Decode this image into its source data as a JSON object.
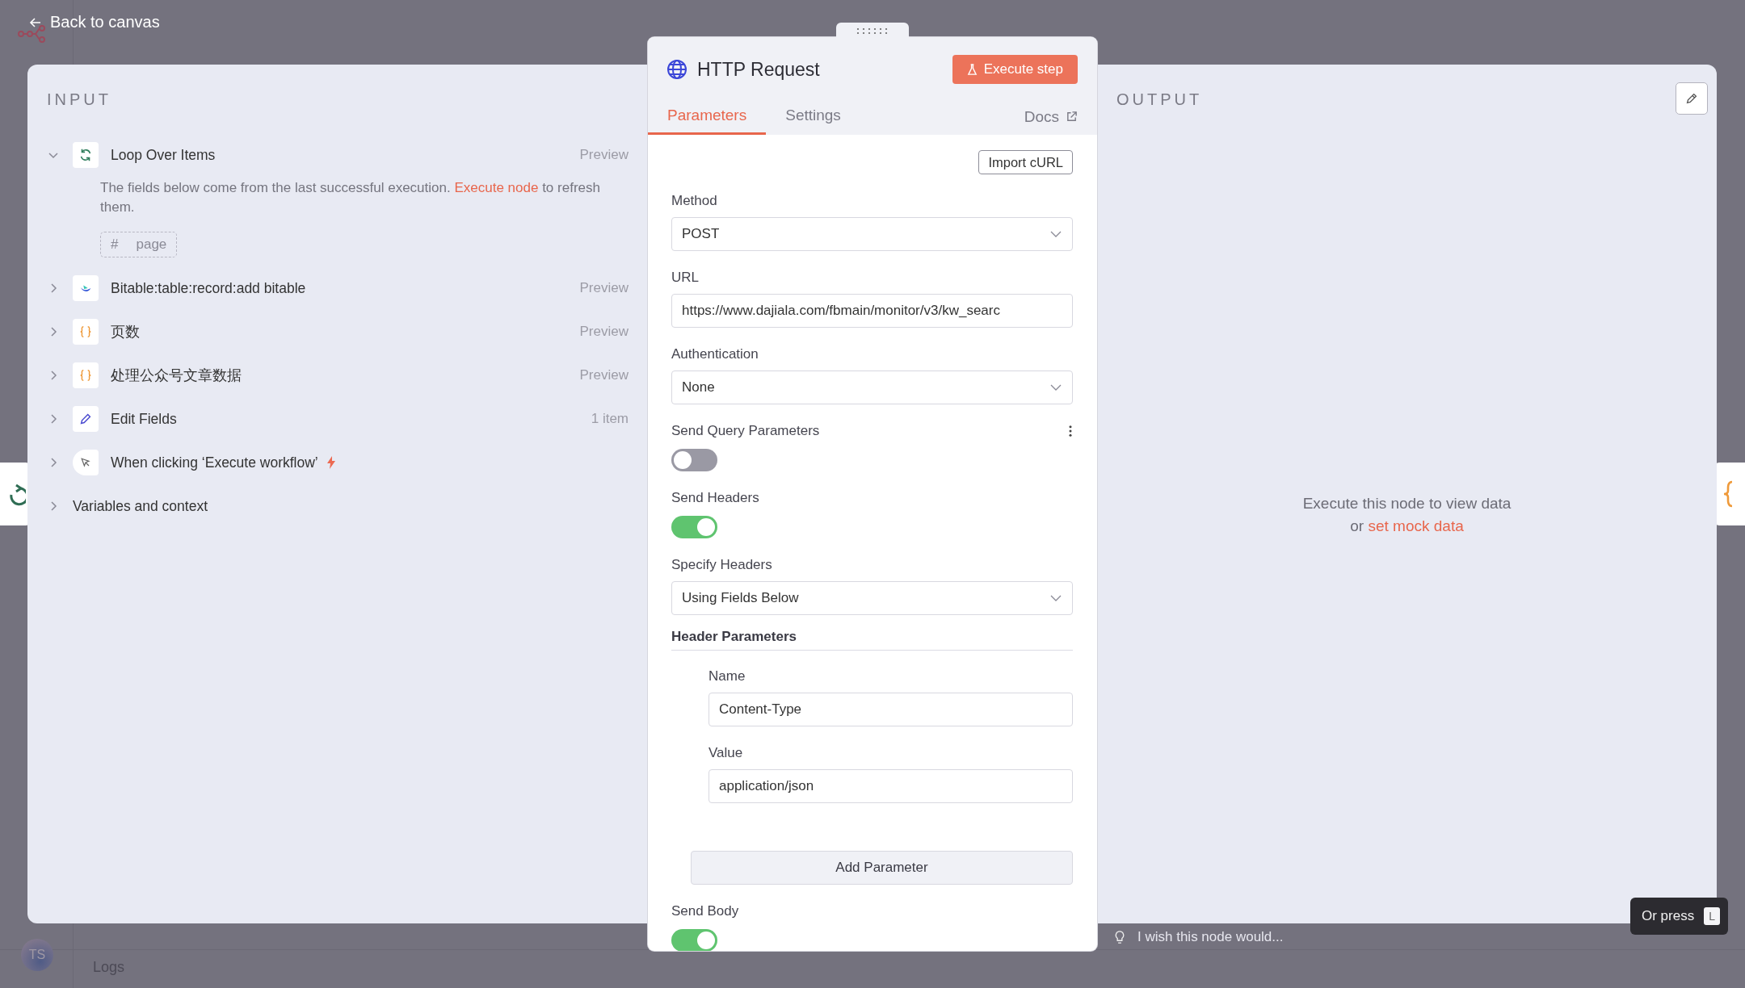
{
  "top_bar": {
    "back_link": "Back to canvas"
  },
  "input_panel": {
    "title": "INPUT",
    "nodes": [
      {
        "name": "Loop Over Items",
        "kind": "loop",
        "meta": "Preview",
        "expanded": true,
        "trigger": false,
        "notice": {
          "before": "The fields below come from the last successful execution.",
          "link": "Execute node",
          "after": "to refresh them."
        },
        "fields": [
          {
            "type": "#",
            "name": "page"
          }
        ]
      },
      {
        "name": "Bitable:table:record:add bitable",
        "kind": "bitable",
        "meta": "Preview",
        "expanded": false,
        "trigger": false
      },
      {
        "name": "页数",
        "kind": "code",
        "meta": "Preview",
        "expanded": false,
        "trigger": false
      },
      {
        "name": "处理公众号文章数据",
        "kind": "code",
        "meta": "Preview",
        "expanded": false,
        "trigger": false
      },
      {
        "name": "Edit Fields",
        "kind": "pencil",
        "meta": "1 item",
        "expanded": false,
        "trigger": false
      },
      {
        "name": "When clicking ‘Execute workflow’",
        "kind": "cursor",
        "expanded": false,
        "trigger": true
      },
      {
        "name": "Variables and context",
        "kind": "context",
        "expanded": false,
        "trigger": false
      }
    ]
  },
  "node_panel": {
    "title": "HTTP Request",
    "execute_button": "Execute step",
    "tabs": [
      {
        "label": "Parameters",
        "selected": true
      },
      {
        "label": "Settings",
        "selected": false
      }
    ],
    "docs_link": "Docs",
    "import_button": "Import cURL",
    "parameters": [
      {
        "kind": "select",
        "label": "Method",
        "value": "POST"
      },
      {
        "kind": "input",
        "label": "URL",
        "value": "https://www.dajiala.com/fbmain/monitor/v3/kw_searc"
      },
      {
        "kind": "select",
        "label": "Authentication",
        "value": "None"
      },
      {
        "kind": "toggle",
        "label": "Send Query Parameters",
        "on": false,
        "options_menu": true
      },
      {
        "kind": "toggle",
        "label": "Send Headers",
        "on": true,
        "options_menu": false
      },
      {
        "kind": "select",
        "label": "Specify Headers",
        "value": "Using Fields Below"
      },
      {
        "kind": "collection",
        "label": "Header Parameters",
        "fields": [
          {
            "label": "Name",
            "value": "Content-Type"
          },
          {
            "label": "Value",
            "value": "application/json"
          }
        ],
        "add_button": "Add Parameter"
      },
      {
        "kind": "toggle",
        "label": "Send Body",
        "on": true,
        "options_menu": false
      }
    ]
  },
  "output_panel": {
    "title": "OUTPUT",
    "empty_message": "Execute this node to view data",
    "or": "or",
    "link": "set mock data"
  },
  "feedback": {
    "placeholder": "I wish this node would..."
  },
  "tooltip": {
    "text": "Or press",
    "key": "L"
  },
  "bottom_bar": {
    "avatar": "TS",
    "logs": "Logs"
  }
}
